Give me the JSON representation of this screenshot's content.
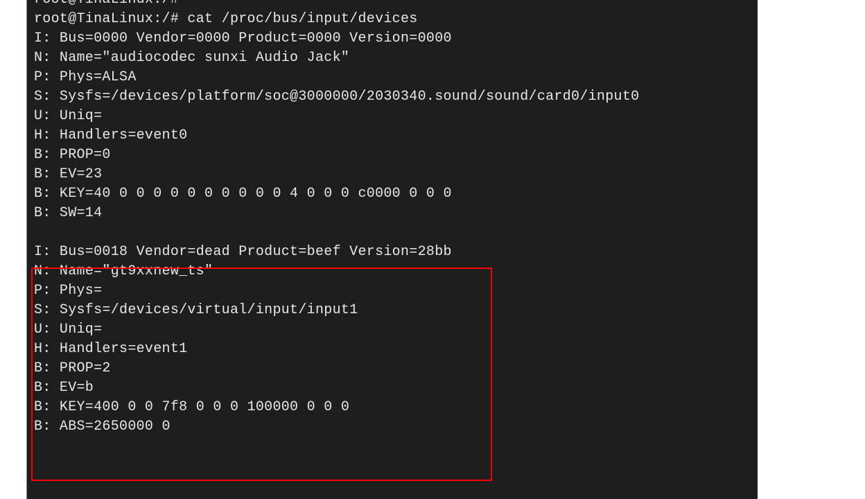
{
  "terminal": {
    "cutoff_line": "root@TinaLinux:/#",
    "prompt_line": "root@TinaLinux:/# cat /proc/bus/input/devices",
    "device1": {
      "l1": "I: Bus=0000 Vendor=0000 Product=0000 Version=0000",
      "l2": "N: Name=\"audiocodec sunxi Audio Jack\"",
      "l3": "P: Phys=ALSA",
      "l4": "S: Sysfs=/devices/platform/soc@3000000/2030340.sound/sound/card0/input0",
      "l5": "U: Uniq=",
      "l6": "H: Handlers=event0",
      "l7": "B: PROP=0",
      "l8": "B: EV=23",
      "l9": "B: KEY=40 0 0 0 0 0 0 0 0 0 0 4 0 0 0 c0000 0 0 0",
      "l10": "B: SW=14"
    },
    "blank": " ",
    "device2": {
      "l1": "I: Bus=0018 Vendor=dead Product=beef Version=28bb",
      "l2": "N: Name=\"gt9xxnew_ts\"",
      "l3": "P: Phys=",
      "l4": "S: Sysfs=/devices/virtual/input/input1",
      "l5": "U: Uniq=",
      "l6": "H: Handlers=event1",
      "l7": "B: PROP=2",
      "l8": "B: EV=b",
      "l9": "B: KEY=400 0 0 7f8 0 0 0 100000 0 0 0",
      "l10": "B: ABS=2650000 0"
    }
  }
}
